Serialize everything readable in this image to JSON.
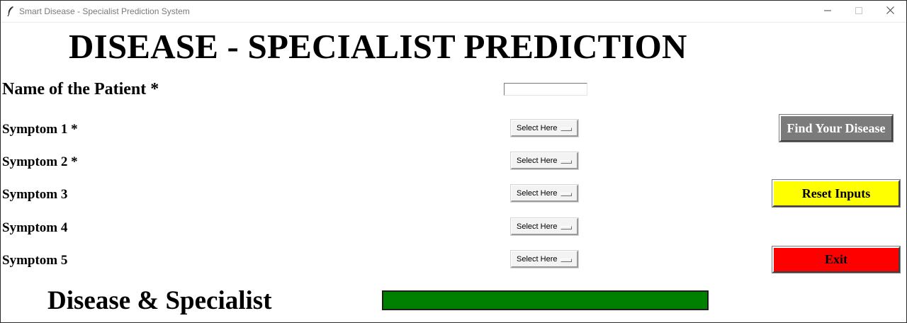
{
  "window": {
    "title": "Smart Disease - Specialist Prediction System",
    "controls": {
      "minimize": "—",
      "maximize": "☐",
      "close": "✕"
    }
  },
  "heading": "DISEASE - SPECIALIST PREDICTION",
  "form": {
    "patient_name_label": "Name of the Patient *",
    "patient_name_value": "",
    "symptoms": [
      {
        "label": "Symptom 1 *",
        "selected": "Select Here"
      },
      {
        "label": "Symptom 2 *",
        "selected": "Select Here"
      },
      {
        "label": "Symptom 3",
        "selected": "Select Here"
      },
      {
        "label": "Symptom 4",
        "selected": "Select Here"
      },
      {
        "label": "Symptom 5",
        "selected": "Select Here"
      }
    ]
  },
  "buttons": {
    "find": {
      "label": "Find Your Disease",
      "bg": "#7b7b7b"
    },
    "reset": {
      "label": "Reset Inputs",
      "bg": "#ffff00"
    },
    "exit": {
      "label": "Exit",
      "bg": "#ff0000"
    }
  },
  "result": {
    "label": "Disease & Specialist",
    "value": "",
    "bg": "#008000"
  },
  "icons": {
    "app": "feather-icon",
    "minimize": "minimize-icon",
    "maximize": "maximize-icon",
    "close": "close-icon",
    "dropdown_indicator": "option-menu-indicator-icon"
  }
}
